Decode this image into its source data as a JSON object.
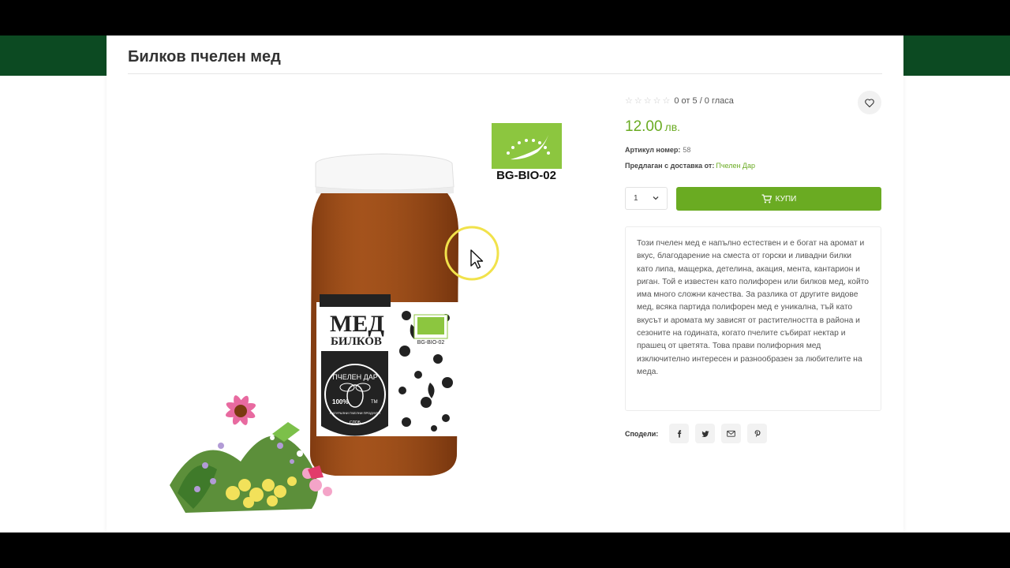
{
  "modal": {
    "title": "Билков пчелен мед"
  },
  "product": {
    "rating": {
      "stars": 5,
      "value": 0,
      "text": "0 от 5 / 0 гласа"
    },
    "price": "12.00",
    "currency": "лв.",
    "sku_label": "Артикул номер:",
    "sku": "58",
    "supplier_label": "Предлаган с доставка от:",
    "supplier": "Пчелен Дар",
    "quantity": "1",
    "buy_label": "КУПИ",
    "description": "Този пчелен мед е напълно естествен и е богат на аромат и вкус, благодарение на сместа от горски и ливадни билки като липа, мащерка, детелина, акация, мента, кантарион и риган. Той е известен като полифорен или билков мед, който има много сложни качества. За разлика от другите видове мед, всяка партида полифорен мед е уникална, тъй като вкусът и аромата му зависят от растителността в района и сезоните на годината, когато пчелите събират нектар и прашец от цветята. Това прави полифорния мед изключително интересен и разнообразен за любителите на меда."
  },
  "image": {
    "bio_code": "BG-BIO-02",
    "label_main": "МЕД",
    "label_sub": "БИЛКОВ",
    "badge_text": "ПЧЕЛЕН ДАР",
    "badge_percent": "100%",
    "badge_tm": "TM",
    "badge_small": "НАТУРАЛНИ ПЧЕЛНИ ПРОДУКТИ",
    "badge_year": "СЛОБ",
    "label_bio": "BG-BIO-02"
  },
  "share": {
    "label": "Сподели:",
    "buttons": [
      "facebook-icon",
      "twitter-icon",
      "email-icon",
      "pinterest-icon"
    ]
  },
  "colors": {
    "accent": "#6aab22",
    "band": "#0c4a22"
  }
}
